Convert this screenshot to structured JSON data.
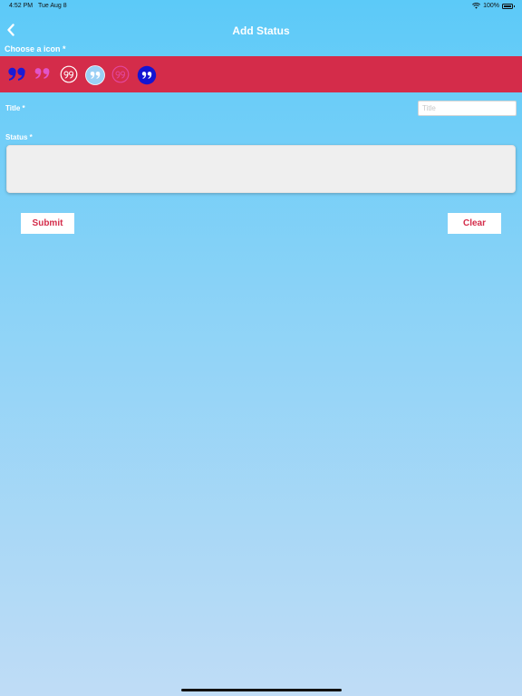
{
  "status_bar": {
    "time": "4:52 PM",
    "date": "Tue Aug 8",
    "battery": "100%"
  },
  "nav": {
    "title": "Add Status",
    "back_icon": "chevron-left-icon"
  },
  "icon_picker": {
    "label": "Choose a icon *",
    "icons": [
      {
        "name": "quote-icon-blue-bold",
        "color": "#1b1bd6"
      },
      {
        "name": "quote-icon-pink",
        "color": "#e254c8"
      },
      {
        "name": "quote-icon-white-circle-outline",
        "color": "#ffffff"
      },
      {
        "name": "quote-icon-lightblue-circle",
        "color": "#9ad0f5"
      },
      {
        "name": "quote-icon-pink-circle-outline",
        "color": "#e2479b"
      },
      {
        "name": "quote-icon-blue-filled-circle",
        "color": "#1414d2"
      }
    ],
    "strip_color": "#d42c4a"
  },
  "title_field": {
    "label": "Title *",
    "placeholder": "Title",
    "value": ""
  },
  "status_field": {
    "label": "Status *",
    "value": ""
  },
  "buttons": {
    "submit": "Submit",
    "clear": "Clear"
  },
  "colors": {
    "accent": "#d42c4a",
    "bg_top": "#5ccaf8",
    "bg_bottom": "#bfdcf6"
  }
}
